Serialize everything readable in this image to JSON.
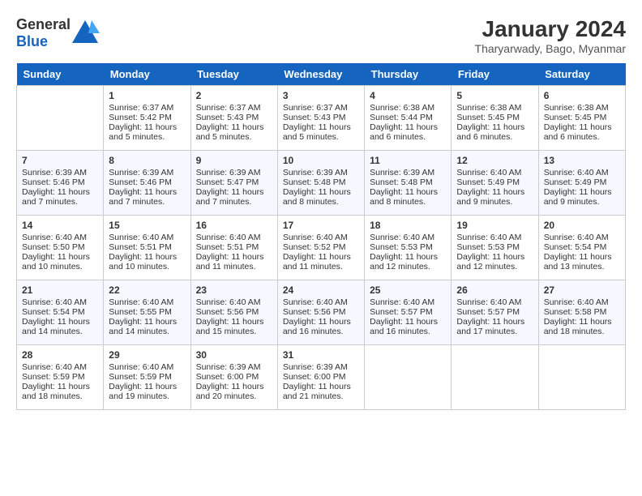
{
  "logo": {
    "general": "General",
    "blue": "Blue"
  },
  "title": {
    "month_year": "January 2024",
    "location": "Tharyarwady, Bago, Myanmar"
  },
  "days_header": [
    "Sunday",
    "Monday",
    "Tuesday",
    "Wednesday",
    "Thursday",
    "Friday",
    "Saturday"
  ],
  "weeks": [
    [
      {
        "day": "",
        "sunrise": "",
        "sunset": "",
        "daylight": ""
      },
      {
        "day": "1",
        "sunrise": "Sunrise: 6:37 AM",
        "sunset": "Sunset: 5:42 PM",
        "daylight": "Daylight: 11 hours and 5 minutes."
      },
      {
        "day": "2",
        "sunrise": "Sunrise: 6:37 AM",
        "sunset": "Sunset: 5:43 PM",
        "daylight": "Daylight: 11 hours and 5 minutes."
      },
      {
        "day": "3",
        "sunrise": "Sunrise: 6:37 AM",
        "sunset": "Sunset: 5:43 PM",
        "daylight": "Daylight: 11 hours and 5 minutes."
      },
      {
        "day": "4",
        "sunrise": "Sunrise: 6:38 AM",
        "sunset": "Sunset: 5:44 PM",
        "daylight": "Daylight: 11 hours and 6 minutes."
      },
      {
        "day": "5",
        "sunrise": "Sunrise: 6:38 AM",
        "sunset": "Sunset: 5:45 PM",
        "daylight": "Daylight: 11 hours and 6 minutes."
      },
      {
        "day": "6",
        "sunrise": "Sunrise: 6:38 AM",
        "sunset": "Sunset: 5:45 PM",
        "daylight": "Daylight: 11 hours and 6 minutes."
      }
    ],
    [
      {
        "day": "7",
        "sunrise": "Sunrise: 6:39 AM",
        "sunset": "Sunset: 5:46 PM",
        "daylight": "Daylight: 11 hours and 7 minutes."
      },
      {
        "day": "8",
        "sunrise": "Sunrise: 6:39 AM",
        "sunset": "Sunset: 5:46 PM",
        "daylight": "Daylight: 11 hours and 7 minutes."
      },
      {
        "day": "9",
        "sunrise": "Sunrise: 6:39 AM",
        "sunset": "Sunset: 5:47 PM",
        "daylight": "Daylight: 11 hours and 7 minutes."
      },
      {
        "day": "10",
        "sunrise": "Sunrise: 6:39 AM",
        "sunset": "Sunset: 5:48 PM",
        "daylight": "Daylight: 11 hours and 8 minutes."
      },
      {
        "day": "11",
        "sunrise": "Sunrise: 6:39 AM",
        "sunset": "Sunset: 5:48 PM",
        "daylight": "Daylight: 11 hours and 8 minutes."
      },
      {
        "day": "12",
        "sunrise": "Sunrise: 6:40 AM",
        "sunset": "Sunset: 5:49 PM",
        "daylight": "Daylight: 11 hours and 9 minutes."
      },
      {
        "day": "13",
        "sunrise": "Sunrise: 6:40 AM",
        "sunset": "Sunset: 5:49 PM",
        "daylight": "Daylight: 11 hours and 9 minutes."
      }
    ],
    [
      {
        "day": "14",
        "sunrise": "Sunrise: 6:40 AM",
        "sunset": "Sunset: 5:50 PM",
        "daylight": "Daylight: 11 hours and 10 minutes."
      },
      {
        "day": "15",
        "sunrise": "Sunrise: 6:40 AM",
        "sunset": "Sunset: 5:51 PM",
        "daylight": "Daylight: 11 hours and 10 minutes."
      },
      {
        "day": "16",
        "sunrise": "Sunrise: 6:40 AM",
        "sunset": "Sunset: 5:51 PM",
        "daylight": "Daylight: 11 hours and 11 minutes."
      },
      {
        "day": "17",
        "sunrise": "Sunrise: 6:40 AM",
        "sunset": "Sunset: 5:52 PM",
        "daylight": "Daylight: 11 hours and 11 minutes."
      },
      {
        "day": "18",
        "sunrise": "Sunrise: 6:40 AM",
        "sunset": "Sunset: 5:53 PM",
        "daylight": "Daylight: 11 hours and 12 minutes."
      },
      {
        "day": "19",
        "sunrise": "Sunrise: 6:40 AM",
        "sunset": "Sunset: 5:53 PM",
        "daylight": "Daylight: 11 hours and 12 minutes."
      },
      {
        "day": "20",
        "sunrise": "Sunrise: 6:40 AM",
        "sunset": "Sunset: 5:54 PM",
        "daylight": "Daylight: 11 hours and 13 minutes."
      }
    ],
    [
      {
        "day": "21",
        "sunrise": "Sunrise: 6:40 AM",
        "sunset": "Sunset: 5:54 PM",
        "daylight": "Daylight: 11 hours and 14 minutes."
      },
      {
        "day": "22",
        "sunrise": "Sunrise: 6:40 AM",
        "sunset": "Sunset: 5:55 PM",
        "daylight": "Daylight: 11 hours and 14 minutes."
      },
      {
        "day": "23",
        "sunrise": "Sunrise: 6:40 AM",
        "sunset": "Sunset: 5:56 PM",
        "daylight": "Daylight: 11 hours and 15 minutes."
      },
      {
        "day": "24",
        "sunrise": "Sunrise: 6:40 AM",
        "sunset": "Sunset: 5:56 PM",
        "daylight": "Daylight: 11 hours and 16 minutes."
      },
      {
        "day": "25",
        "sunrise": "Sunrise: 6:40 AM",
        "sunset": "Sunset: 5:57 PM",
        "daylight": "Daylight: 11 hours and 16 minutes."
      },
      {
        "day": "26",
        "sunrise": "Sunrise: 6:40 AM",
        "sunset": "Sunset: 5:57 PM",
        "daylight": "Daylight: 11 hours and 17 minutes."
      },
      {
        "day": "27",
        "sunrise": "Sunrise: 6:40 AM",
        "sunset": "Sunset: 5:58 PM",
        "daylight": "Daylight: 11 hours and 18 minutes."
      }
    ],
    [
      {
        "day": "28",
        "sunrise": "Sunrise: 6:40 AM",
        "sunset": "Sunset: 5:59 PM",
        "daylight": "Daylight: 11 hours and 18 minutes."
      },
      {
        "day": "29",
        "sunrise": "Sunrise: 6:40 AM",
        "sunset": "Sunset: 5:59 PM",
        "daylight": "Daylight: 11 hours and 19 minutes."
      },
      {
        "day": "30",
        "sunrise": "Sunrise: 6:39 AM",
        "sunset": "Sunset: 6:00 PM",
        "daylight": "Daylight: 11 hours and 20 minutes."
      },
      {
        "day": "31",
        "sunrise": "Sunrise: 6:39 AM",
        "sunset": "Sunset: 6:00 PM",
        "daylight": "Daylight: 11 hours and 21 minutes."
      },
      {
        "day": "",
        "sunrise": "",
        "sunset": "",
        "daylight": ""
      },
      {
        "day": "",
        "sunrise": "",
        "sunset": "",
        "daylight": ""
      },
      {
        "day": "",
        "sunrise": "",
        "sunset": "",
        "daylight": ""
      }
    ]
  ]
}
